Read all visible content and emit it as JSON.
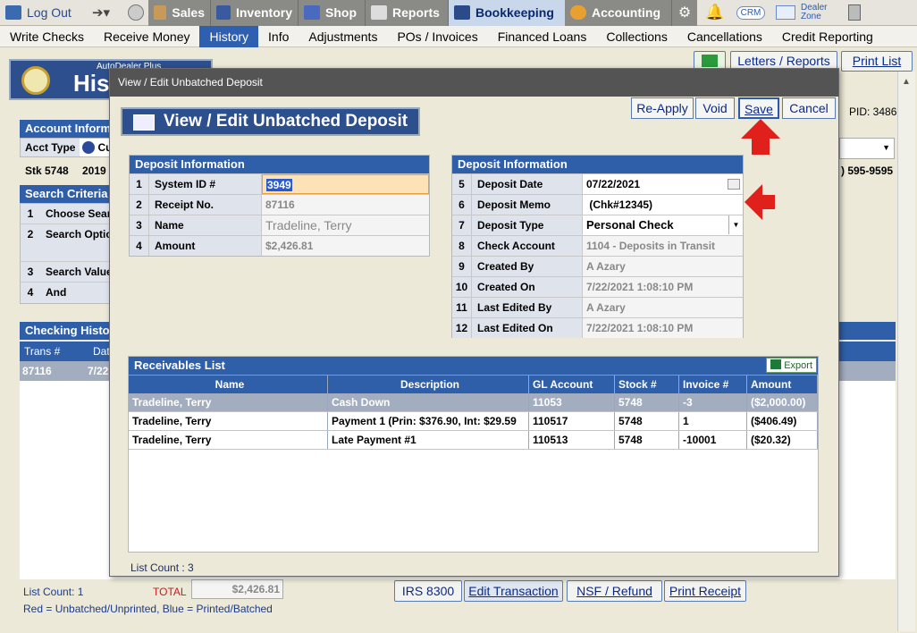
{
  "topnav": {
    "logout": "Log Out",
    "sales": "Sales",
    "inventory": "Inventory",
    "shop": "Shop",
    "reports": "Reports",
    "bookkeeping": "Bookkeeping",
    "accounting": "Accounting",
    "crm": "CRM",
    "dealer_zone_1": "Dealer",
    "dealer_zone_2": "Zone"
  },
  "menu": [
    "Write Checks",
    "Receive Money",
    "History",
    "Info",
    "Adjustments",
    "POs / Invoices",
    "Financed Loans",
    "Collections",
    "Cancellations",
    "Credit Reporting"
  ],
  "background": {
    "brand_small": "AutoDealer Plus",
    "brand_big": "His",
    "letters_reports": "Letters / Reports",
    "print_list": "Print List",
    "pid": "PID: 3486",
    "account_info": "Account Inform",
    "acct_type_label": "Acct Type",
    "acct_type_value": "Cu",
    "stk": "Stk 5748",
    "year": "2019",
    "phone": ") 595-9595",
    "search_criteria": "Search Criteria",
    "sc_rows": [
      {
        "n": "1",
        "label": "Choose Sear"
      },
      {
        "n": "2",
        "label": "Search Optic"
      },
      {
        "n": "3",
        "label": "Search Value"
      },
      {
        "n": "4",
        "label": "And"
      }
    ],
    "checking_history": "Checking Histo",
    "ch_col1": "Trans #",
    "ch_col2": "Dat",
    "ch_row_trans": "87116",
    "ch_row_date": "7/22",
    "list_count": "List Count: 1",
    "total_label": "TOTAL",
    "total_value": "$2,426.81",
    "legend": "Red = Unbatched/Unprinted, Blue = Printed/Batched",
    "irs": "IRS 8300",
    "edit_transaction": "Edit Transaction",
    "nsf_refund": "NSF / Refund",
    "print_receipt": "Print Receipt"
  },
  "modal": {
    "window_title": "View / Edit Unbatched Deposit",
    "banner": "View / Edit Unbatched Deposit",
    "buttons": {
      "reapply": "Re-Apply",
      "void": "Void",
      "save": "Save",
      "cancel": "Cancel"
    },
    "left_header": "Deposit Information",
    "left_rows": [
      {
        "n": "1",
        "label": "System ID #",
        "value": "3949"
      },
      {
        "n": "2",
        "label": "Receipt No.",
        "value": "87116"
      },
      {
        "n": "3",
        "label": "Name",
        "value": "Tradeline, Terry"
      },
      {
        "n": "4",
        "label": "Amount",
        "value": "$2,426.81"
      }
    ],
    "right_header": "Deposit Information",
    "right_rows": [
      {
        "n": "5",
        "label": "Deposit Date",
        "value": "07/22/2021"
      },
      {
        "n": "6",
        "label": "Deposit Memo",
        "value": " (Chk#12345)"
      },
      {
        "n": "7",
        "label": "Deposit Type",
        "value": "Personal Check"
      },
      {
        "n": "8",
        "label": "Check Account",
        "value": "1104 - Deposits in Transit"
      },
      {
        "n": "9",
        "label": "Created By",
        "value": "A Azary"
      },
      {
        "n": "10",
        "label": "Created On",
        "value": "7/22/2021 1:08:10 PM"
      },
      {
        "n": "11",
        "label": "Last Edited By",
        "value": "A Azary"
      },
      {
        "n": "12",
        "label": "Last Edited On",
        "value": "7/22/2021 1:08:10 PM"
      }
    ],
    "receivables": {
      "title": "Receivables List",
      "export": "Export",
      "columns": [
        "Name",
        "Description",
        "GL Account",
        "Stock #",
        "Invoice #",
        "Amount"
      ],
      "rows": [
        [
          "Tradeline, Terry",
          "Cash Down",
          "11053",
          "5748",
          "-3",
          "($2,000.00)"
        ],
        [
          "Tradeline, Terry",
          "Payment 1 (Prin: $376.90, Int: $29.59",
          "110517",
          "5748",
          "1",
          "($406.49)"
        ],
        [
          "Tradeline, Terry",
          "Late Payment #1",
          "110513",
          "5748",
          "-10001",
          "($20.32)"
        ]
      ]
    },
    "list_count": "List Count : 3"
  },
  "colors": {
    "accent": "#2f5fa8",
    "annotation_arrow": "#e0201a"
  }
}
